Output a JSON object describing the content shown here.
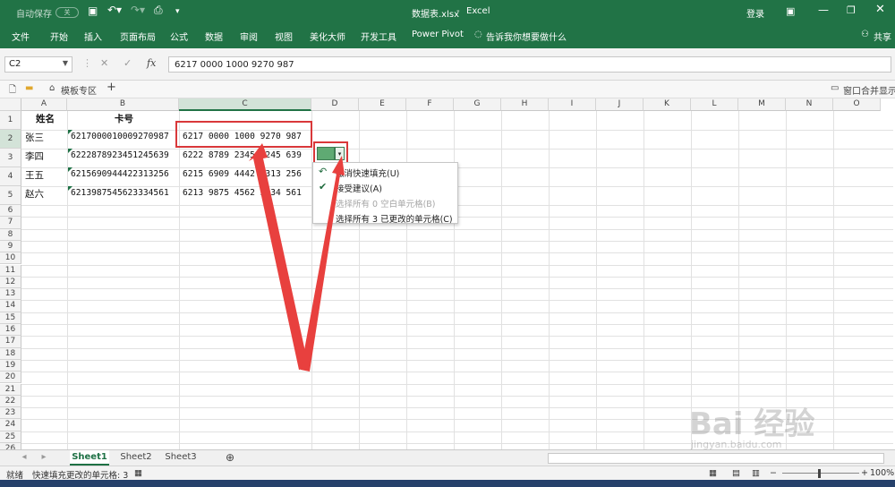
{
  "title_bar": {
    "autosave_label": "自动保存",
    "autosave_state": "关",
    "filename": "数据表.xlsx",
    "app_name": "Excel",
    "login": "登录"
  },
  "ribbon": {
    "tabs": [
      "文件",
      "开始",
      "插入",
      "页面布局",
      "公式",
      "数据",
      "审阅",
      "视图",
      "美化大师",
      "开发工具",
      "Power Pivot"
    ],
    "tell_me": "告诉我你想要做什么",
    "share": "共享"
  },
  "formula_bar": {
    "name_box": "C2",
    "fx": "fx",
    "content": "6217 0000 1000 9270 987"
  },
  "toolbar2": {
    "template_tab": "模板专区",
    "window_merge": "窗口合并显示"
  },
  "columns": [
    "A",
    "B",
    "C",
    "D",
    "E",
    "F",
    "G",
    "H",
    "I",
    "J",
    "K",
    "L",
    "M",
    "N",
    "O"
  ],
  "rows": [
    "1",
    "2",
    "3",
    "4",
    "5",
    "6",
    "7",
    "8",
    "9",
    "10",
    "11",
    "12",
    "13",
    "14",
    "15",
    "16",
    "17",
    "18",
    "19",
    "20",
    "21",
    "22",
    "23",
    "24",
    "25",
    "26"
  ],
  "cells": {
    "A1": "姓名",
    "B1": "卡号",
    "A2": "张三",
    "B2": "6217000010009270987",
    "C2": "6217  0000  1000  9270  987",
    "A3": "李四",
    "B3": "6222878923451245639",
    "C3": "6222  8789  2345  1245  639",
    "A4": "王五",
    "B4": "6215690944422313256",
    "C4": "6215  6909  4442  2313  256",
    "A5": "赵六",
    "B5": "6213987545623334561",
    "C5": "6213  9875  4562  3334  561"
  },
  "flashfill_menu": {
    "items": [
      {
        "label": "撤消快速填充(U)",
        "enabled": true,
        "icon": "undo-icon"
      },
      {
        "label": "接受建议(A)",
        "enabled": true,
        "icon": "check-icon"
      },
      {
        "label": "选择所有 0 空白单元格(B)",
        "enabled": false,
        "icon": ""
      },
      {
        "label": "选择所有 3 已更改的单元格(C)",
        "enabled": true,
        "icon": ""
      }
    ]
  },
  "sheets": [
    "Sheet1",
    "Sheet2",
    "Sheet3"
  ],
  "active_sheet": "Sheet1",
  "status_bar": {
    "ready": "就绪",
    "message": "快速填充更改的单元格: 3",
    "zoom": "100%"
  },
  "watermark": {
    "text": "Bai 经验",
    "url": "jingyan.baidu.com"
  },
  "colors": {
    "accent": "#217346",
    "highlight": "#d9383a"
  }
}
